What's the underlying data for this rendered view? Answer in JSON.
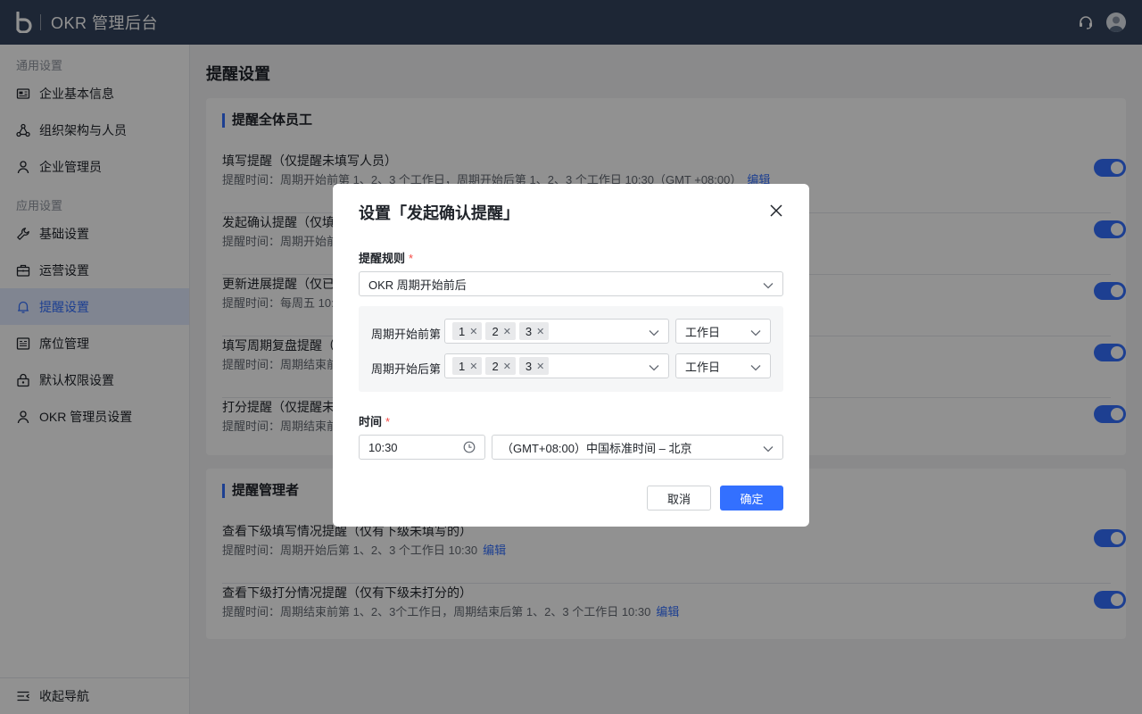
{
  "app": {
    "title": "OKR 管理后台"
  },
  "sidebar": {
    "groups": [
      {
        "label": "通用设置",
        "items": [
          {
            "label": "企业基本信息",
            "icon": "id-card-icon"
          },
          {
            "label": "组织架构与人员",
            "icon": "org-chart-icon"
          },
          {
            "label": "企业管理员",
            "icon": "user-icon"
          }
        ]
      },
      {
        "label": "应用设置",
        "items": [
          {
            "label": "基础设置",
            "icon": "wrench-icon"
          },
          {
            "label": "运营设置",
            "icon": "briefcase-icon"
          },
          {
            "label": "提醒设置",
            "icon": "bell-icon",
            "active": true
          },
          {
            "label": "席位管理",
            "icon": "seat-list-icon"
          },
          {
            "label": "默认权限设置",
            "icon": "lock-icon"
          },
          {
            "label": "OKR 管理员设置",
            "icon": "user-icon"
          }
        ]
      }
    ],
    "collapse_label": "收起导航"
  },
  "page": {
    "title": "提醒设置"
  },
  "cards": [
    {
      "title": "提醒全体员工",
      "rows": [
        {
          "title": "填写提醒（仅提醒未填写人员）",
          "desc": "提醒时间：周期开始前第 1、2、3 个工作日，周期开始后第 1、2、3 个工作日 10:30（GMT +08:00）",
          "edit": "编辑",
          "enabled": true
        },
        {
          "title": "发起确认提醒（仅填未",
          "desc": "提醒时间：周期开始前",
          "edit": "",
          "enabled": true
        },
        {
          "title": "更新进展提醒（仅已填",
          "desc": "提醒时间：每周五 10:3",
          "edit": "",
          "enabled": true
        },
        {
          "title": "填写周期复盘提醒（仅",
          "desc": "提醒时间：周期结束前",
          "edit": "",
          "enabled": true
        },
        {
          "title": "打分提醒（仅提醒未打",
          "desc": "提醒时间：周期结束前",
          "edit": "",
          "enabled": true
        }
      ]
    },
    {
      "title": "提醒管理者",
      "rows": [
        {
          "title": "查看下级填写情况提醒（仅有下级未填写的）",
          "desc": "提醒时间：周期开始后第 1、2、3 个工作日 10:30",
          "edit": "编辑",
          "enabled": true
        },
        {
          "title": "查看下级打分情况提醒（仅有下级未打分的）",
          "desc": "提醒时间：周期结束前第 1、2、3个工作日，周期结束后第 1、2、3 个工作日 10:30",
          "edit": "编辑",
          "enabled": true
        }
      ]
    }
  ],
  "modal": {
    "title": "设置「发起确认提醒」",
    "rule_label": "提醒规则",
    "rule_value": "OKR 周期开始前后",
    "before_label": "周期开始前第",
    "before_tags": [
      "1",
      "2",
      "3"
    ],
    "before_unit": "工作日",
    "after_label": "周期开始后第",
    "after_tags": [
      "1",
      "2",
      "3"
    ],
    "after_unit": "工作日",
    "time_label": "时间",
    "time_value": "10:30",
    "timezone_value": "（GMT+08:00）中国标准时间 – 北京",
    "required_mark": "*",
    "cancel_label": "取消",
    "ok_label": "确定"
  },
  "colors": {
    "accent": "#3370ff",
    "topbar": "#34435e",
    "required": "#f54a45"
  }
}
